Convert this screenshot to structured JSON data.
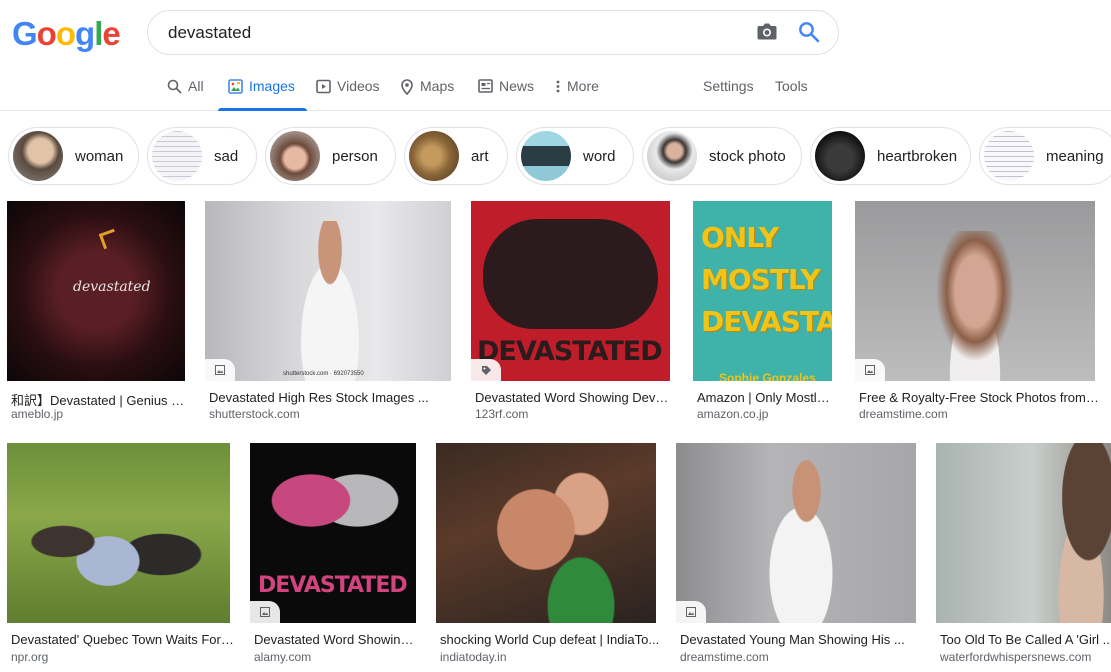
{
  "logo": {
    "letters": [
      "G",
      "o",
      "o",
      "g",
      "l",
      "e"
    ],
    "colors": [
      "#4285f4",
      "#ea4335",
      "#fbbc05",
      "#4285f4",
      "#34a853",
      "#ea4335"
    ]
  },
  "search": {
    "query": "devastated"
  },
  "tabs": [
    {
      "label": "All",
      "icon": "search-icon"
    },
    {
      "label": "Images",
      "icon": "image-icon",
      "active": true
    },
    {
      "label": "Videos",
      "icon": "play-icon"
    },
    {
      "label": "Maps",
      "icon": "pin-icon"
    },
    {
      "label": "News",
      "icon": "news-icon"
    },
    {
      "label": "More",
      "icon": "more-vert-icon"
    }
  ],
  "tools": {
    "settings": "Settings",
    "tools": "Tools"
  },
  "chips": [
    {
      "label": "woman"
    },
    {
      "label": "sad"
    },
    {
      "label": "person"
    },
    {
      "label": "art"
    },
    {
      "label": "word"
    },
    {
      "label": "stock photo"
    },
    {
      "label": "heartbroken"
    },
    {
      "label": "meaning"
    }
  ],
  "results_row1": [
    {
      "title": "和訳】Devastated | Genius & ...",
      "source": "ameblo.jp",
      "caption": "devastated"
    },
    {
      "title": "Devastated High Res Stock Images ...",
      "source": "shutterstock.com",
      "caption": "shutterstock.com · 692073550"
    },
    {
      "title": "Devastated Word Showing Devas...",
      "source": "123rf.com",
      "caption": "DEVASTATED"
    },
    {
      "title": "Amazon | Only Mostly ...",
      "source": "amazon.co.jp",
      "caption": "ONLY MOSTLY DEVASTATED",
      "author": "Sophie Gonzales"
    },
    {
      "title": "Free & Royalty-Free Stock Photos from ...",
      "source": "dreamstime.com"
    }
  ],
  "results_row2": [
    {
      "title": "Devastated' Quebec Town Waits For ...",
      "source": "npr.org"
    },
    {
      "title": "Devastated Word Showing ...",
      "source": "alamy.com",
      "caption": "DEVASTATED"
    },
    {
      "title": "shocking World Cup defeat | IndiaTo...",
      "source": "indiatoday.in"
    },
    {
      "title": "Devastated Young Man Showing His ...",
      "source": "dreamstime.com"
    },
    {
      "title": "Too Old To Be Called A 'Girl ...",
      "source": "waterfordwhispersnews.com"
    }
  ],
  "colors": {
    "accent": "#1a73e8",
    "text": "#202124",
    "muted": "#5f6368"
  }
}
